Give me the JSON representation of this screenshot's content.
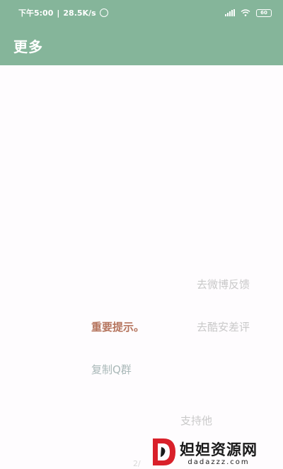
{
  "status_bar": {
    "time": "下午5:00",
    "separator": "|",
    "speed": "28.5K/s",
    "battery": "60"
  },
  "app_bar": {
    "title": "更多"
  },
  "menu": {
    "weibo_feedback": "去微博反馈",
    "coolapk_review": "去酷安差评",
    "important_notice": "重要提示。",
    "copy_qq_group": "复制Q群",
    "support": "支持他",
    "page_indicator": "2/"
  },
  "watermark": {
    "name": "妲妲资源网",
    "domain": "dadazzz.com"
  },
  "colors": {
    "accent": "#85b59a",
    "notice": "#b5745d",
    "faded_text": "#c9c9c9",
    "qq_text": "#a9b8b8",
    "logo_red": "#d9202a"
  }
}
